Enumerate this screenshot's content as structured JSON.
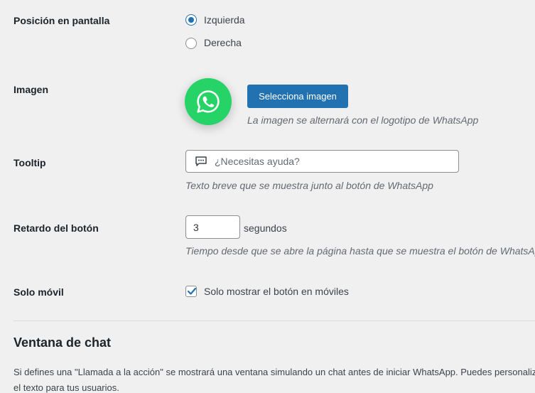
{
  "position": {
    "label": "Posición en pantalla",
    "options": [
      {
        "label": "Izquierda",
        "checked": true
      },
      {
        "label": "Derecha",
        "checked": false
      }
    ]
  },
  "image": {
    "label": "Imagen",
    "logo_icon": "whatsapp-icon",
    "select_button": "Selecciona imagen",
    "description": "La imagen se alternará con el logotipo de WhatsApp"
  },
  "tooltip": {
    "label": "Tooltip",
    "icon": "chat-bubble-icon",
    "placeholder": "¿Necesitas ayuda?",
    "value": "",
    "description": "Texto breve que se muestra junto al botón de WhatsApp"
  },
  "delay": {
    "label": "Retardo del botón",
    "value": "3",
    "unit": "segundos",
    "description": "Tiempo desde que se abre la página hasta que se muestra el botón de WhatsApp"
  },
  "mobile_only": {
    "label": "Solo móvil",
    "checked": true,
    "checkbox_label": "Solo mostrar el botón en móviles"
  },
  "chat_window": {
    "title": "Ventana de chat",
    "description": "Si defines una \"Llamada a la acción\" se mostrará una ventana simulando un chat antes de iniciar WhatsApp. Puedes personalizar el texto para tus usuarios."
  },
  "colors": {
    "accent": "#2271b1",
    "whatsapp_green": "#25d366",
    "background": "#f0f0f1"
  }
}
